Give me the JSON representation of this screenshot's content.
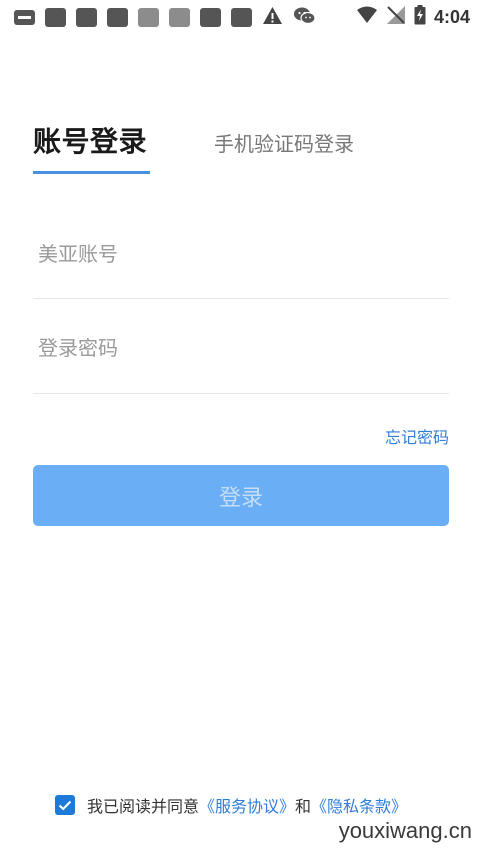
{
  "status_bar": {
    "time": "4:04",
    "left_icons": [
      "chat-icon",
      "notification-icon",
      "notification-icon",
      "notification-icon",
      "notification-icon",
      "notification-icon",
      "notification-icon",
      "notification-icon",
      "warning-icon",
      "wechat-icon"
    ],
    "right_icons": [
      "wifi-icon",
      "signal-icon",
      "battery-icon"
    ]
  },
  "tabs": {
    "account_login": "账号登录",
    "phone_login": "手机验证码登录"
  },
  "form": {
    "account_placeholder": "美亚账号",
    "password_placeholder": "登录密码",
    "account_value": "",
    "password_value": ""
  },
  "forgot_password": "忘记密码",
  "login_button": "登录",
  "agreement": {
    "checked": true,
    "text_prefix": "我已阅读并同意",
    "service_link": "《服务协议》",
    "connector": "和",
    "privacy_link": "《隐私条款》"
  },
  "watermark": "youxiwang.cn",
  "colors": {
    "accent": "#4a90e2",
    "link": "#2f7ed8",
    "button_bg": "#6aaef6",
    "button_text": "#c5def8",
    "checkbox": "#1e7ad7"
  }
}
